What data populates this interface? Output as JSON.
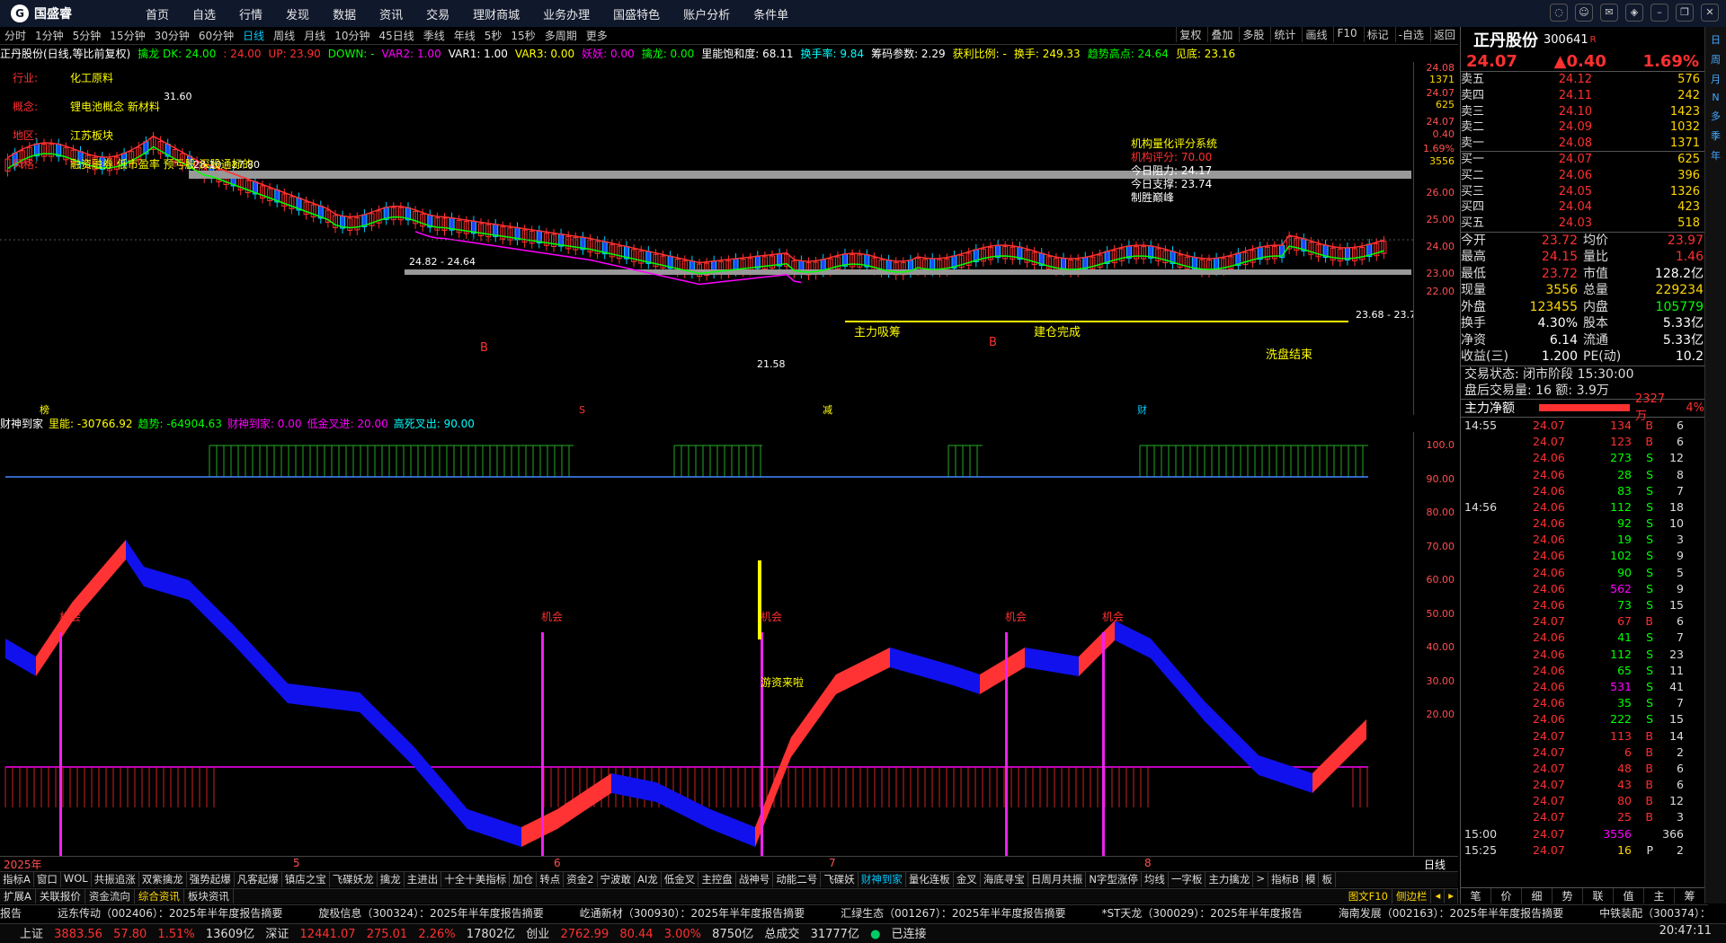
{
  "menu": {
    "brand": "国盛睿",
    "items": [
      "首页",
      "自选",
      "行情",
      "发现",
      "数据",
      "资讯",
      "交易",
      "理财商城",
      "业务办理",
      "国盛特色",
      "账户分析",
      "条件单"
    ],
    "win_icons": [
      "chat-icon",
      "person-icon",
      "mail-icon",
      "skin-icon",
      "minimize-icon",
      "restore-icon",
      "close-icon"
    ]
  },
  "periods": {
    "items": [
      "分时",
      "1分钟",
      "5分钟",
      "15分钟",
      "30分钟",
      "60分钟",
      "日线",
      "周线",
      "月线",
      "10分钟",
      "45日线",
      "季线",
      "年线",
      "5秒",
      "15秒",
      "多周期",
      "更多"
    ],
    "active": "日线",
    "right_tools": [
      "复权",
      "叠加",
      "多股",
      "统计",
      "画线",
      "F10",
      "标记",
      "-自选",
      "返回"
    ]
  },
  "ind_line": [
    {
      "t": "正丹股份(日线,等比前复权)",
      "c": "#ffffff"
    },
    {
      "t": "擒龙 DK: 24.00",
      "c": "#00ff00"
    },
    {
      "t": ": 24.00",
      "c": "#ff3030"
    },
    {
      "t": "UP: 23.90",
      "c": "#ff3030"
    },
    {
      "t": "DOWN: -",
      "c": "#00ff00"
    },
    {
      "t": "VAR2: 1.00",
      "c": "#ff00ff"
    },
    {
      "t": "VAR1: 1.00",
      "c": "#ffffff"
    },
    {
      "t": "VAR3: 0.00",
      "c": "#ffff00"
    },
    {
      "t": "妖妖: 0.00",
      "c": "#ff00ff"
    },
    {
      "t": "擒龙: 0.00",
      "c": "#00ff00"
    },
    {
      "t": "里能饱和度: 68.11",
      "c": "#ffffff"
    },
    {
      "t": "换手率: 9.84",
      "c": "#00ffff"
    },
    {
      "t": "筹码参数: 2.29",
      "c": "#ffffff"
    },
    {
      "t": "获利比例: -",
      "c": "#ffff00"
    },
    {
      "t": "换手: 249.33",
      "c": "#ffff00"
    },
    {
      "t": "趋势高点: 24.64",
      "c": "#00ff00"
    },
    {
      "t": "见底: 23.16",
      "c": "#ffff00"
    }
  ],
  "info_panel": {
    "rows": [
      {
        "k": "行业:",
        "v": "化工原料"
      },
      {
        "k": "概念:",
        "v": "锂电池概念 新材料"
      },
      {
        "k": "地区:",
        "v": "江苏板块"
      },
      {
        "k": "风格:",
        "v": "融资融券 低市盈率 预亏股 深股通标的"
      }
    ]
  },
  "score_panel": {
    "title": "机构量化评分系统",
    "score": "机构评分: 70.00",
    "res": "今日阻力: 24.17",
    "sup": "今日支撑: 23.74",
    "tag": "制胜巅峰"
  },
  "annotations": {
    "a1": "28.10 - 27.80",
    "a2": "24.82 - 24.64",
    "a3": "23.68 - 23.7",
    "low": "21.58",
    "hi": "31.60",
    "zl": "主力吸筹",
    "jc": "建仓完成",
    "xp": "洗盘结束",
    "b": "B",
    "s": "S",
    "jian": "减",
    "cai": "财",
    "bang": "榜"
  },
  "yaxis1": {
    "labels": [
      "24.08",
      "1371",
      "24.07",
      "625",
      "24.07",
      "0.40",
      "1.69%",
      "3556",
      "26.00",
      "25.00",
      "24.00",
      "23.00",
      "22.00"
    ]
  },
  "sub_line": [
    {
      "t": "财神到家",
      "c": "#ffffff"
    },
    {
      "t": "里能: -30766.92",
      "c": "#ffff00"
    },
    {
      "t": "趋势: -64904.63",
      "c": "#00ff00"
    },
    {
      "t": "财神到家: 0.00",
      "c": "#ff00ff"
    },
    {
      "t": "低金叉进: 20.00",
      "c": "#ff00ff"
    },
    {
      "t": "高死叉出: 90.00",
      "c": "#00ffff"
    }
  ],
  "sub_labels": {
    "chance": "机会",
    "fund": "游资来啦"
  },
  "yaxis2": {
    "labels": [
      "100.0",
      "90.00",
      "80.00",
      "70.00",
      "60.00",
      "50.00",
      "40.00",
      "30.00",
      "20.00"
    ]
  },
  "dates": {
    "year": "2025年",
    "m5": "5",
    "m6": "6",
    "m7": "7",
    "m8": "8",
    "right": "日线"
  },
  "tabs1": {
    "items": [
      "指标A",
      "窗口",
      "WOL",
      "共振追涨",
      "双紫擒龙",
      "强势起爆",
      "凡客起爆",
      "镇店之宝",
      "飞碟妖龙",
      "擒龙",
      "主进出",
      "十全十美指标",
      "加仓",
      "转点",
      "资金2",
      "宁波敢",
      "AI龙",
      "低金叉",
      "主控盘",
      "战神号",
      "动能二号",
      "飞碟妖",
      "财神到家",
      "量化连板",
      "金叉",
      "海底寻宝",
      "日周月共振",
      "N字型涨停",
      "均线",
      "一字板",
      "主力擒龙",
      ">",
      "指标B",
      "模",
      "板"
    ],
    "active": "财神到家"
  },
  "tabs2": {
    "items": [
      "扩展A",
      "关联报价",
      "资金流向",
      "综合资讯",
      "板块资讯"
    ],
    "active": "综合资讯",
    "right": [
      "图文F10",
      "侧边栏",
      "◂",
      "▸"
    ]
  },
  "news": [
    "报告",
    "远东传动（002406）：2025年半年度报告摘要",
    "旋极信息（300324）：2025年半年度报告摘要",
    "屹通新材（300930）：2025年半年度报告摘要",
    "汇绿生态（001267）：2025年半年度报告摘要",
    "*ST天龙（300029）：2025年半年度报告",
    "海南发展（002163）：2025年半年度报告摘要",
    "中铁装配（300374）：2025年半年度报告"
  ],
  "status": {
    "sh": "上证",
    "sh_v": "3883.56",
    "sh_c": "57.80",
    "sh_p": "1.51%",
    "sh_a": "13609亿",
    "sz": "深证",
    "sz_v": "12441.07",
    "sz_c": "275.01",
    "sz_p": "2.26%",
    "sz_a": "17802亿",
    "cy": "创业",
    "cy_v": "2762.99",
    "cy_c": "80.44",
    "cy_p": "3.00%",
    "cy_a": "8750亿",
    "tot": "总成交",
    "tot_v": "31777亿",
    "conn": "已连接",
    "time": "20:47:11"
  },
  "stock": {
    "name": "正丹股份",
    "code": "300641",
    "mark": "R",
    "price": "24.07",
    "chg": "▲0.40",
    "pct": "1.69%"
  },
  "orderbook": [
    {
      "l": "卖五",
      "p": "24.12",
      "v": "576"
    },
    {
      "l": "卖四",
      "p": "24.11",
      "v": "242"
    },
    {
      "l": "卖三",
      "p": "24.10",
      "v": "1423"
    },
    {
      "l": "卖二",
      "p": "24.09",
      "v": "1032"
    },
    {
      "l": "卖一",
      "p": "24.08",
      "v": "1371"
    },
    {
      "l": "买一",
      "p": "24.07",
      "v": "625"
    },
    {
      "l": "买二",
      "p": "24.06",
      "v": "396"
    },
    {
      "l": "买三",
      "p": "24.05",
      "v": "1326"
    },
    {
      "l": "买四",
      "p": "24.04",
      "v": "423"
    },
    {
      "l": "买五",
      "p": "24.03",
      "v": "518"
    }
  ],
  "stats": [
    {
      "a": "今开",
      "b": "23.72",
      "c": "均价",
      "d": "23.97"
    },
    {
      "a": "最高",
      "b": "24.15",
      "c": "量比",
      "d": "1.46"
    },
    {
      "a": "最低",
      "b": "23.72",
      "c": "市值",
      "d": "128.2亿"
    },
    {
      "a": "现量",
      "b": "3556",
      "c": "总量",
      "d": "229234"
    },
    {
      "a": "外盘",
      "b": "123455",
      "c": "内盘",
      "d": "105779"
    },
    {
      "a": "换手",
      "b": "4.30%",
      "c": "股本",
      "d": "5.33亿"
    },
    {
      "a": "净资",
      "b": "6.14",
      "c": "流通",
      "d": "5.33亿"
    },
    {
      "a": "收益(三)",
      "b": "1.200",
      "c": "PE(动)",
      "d": "10.2"
    }
  ],
  "trade_state": "交易状态: 闭市阶段 15:30:00",
  "after_trade": "盘后交易量: 16  额: 3.9万",
  "netflow": {
    "label": "主力净额",
    "value": "2327万",
    "pct": "4%"
  },
  "ticks": [
    {
      "t": "14:55",
      "p": "24.07",
      "v": "134",
      "d": "B",
      "n": "6"
    },
    {
      "t": "",
      "p": "24.07",
      "v": "123",
      "d": "B",
      "n": "6"
    },
    {
      "t": "",
      "p": "24.06",
      "v": "273",
      "d": "S",
      "n": "12"
    },
    {
      "t": "",
      "p": "24.06",
      "v": "28",
      "d": "S",
      "n": "8"
    },
    {
      "t": "",
      "p": "24.06",
      "v": "83",
      "d": "S",
      "n": "7"
    },
    {
      "t": "14:56",
      "p": "24.06",
      "v": "112",
      "d": "S",
      "n": "18"
    },
    {
      "t": "",
      "p": "24.06",
      "v": "92",
      "d": "S",
      "n": "10"
    },
    {
      "t": "",
      "p": "24.06",
      "v": "19",
      "d": "S",
      "n": "3"
    },
    {
      "t": "",
      "p": "24.06",
      "v": "102",
      "d": "S",
      "n": "9"
    },
    {
      "t": "",
      "p": "24.06",
      "v": "90",
      "d": "S",
      "n": "5"
    },
    {
      "t": "",
      "p": "24.06",
      "v": "562",
      "d": "S",
      "n": "9"
    },
    {
      "t": "",
      "p": "24.06",
      "v": "73",
      "d": "S",
      "n": "15"
    },
    {
      "t": "",
      "p": "24.07",
      "v": "67",
      "d": "B",
      "n": "6"
    },
    {
      "t": "",
      "p": "24.06",
      "v": "41",
      "d": "S",
      "n": "7"
    },
    {
      "t": "",
      "p": "24.06",
      "v": "112",
      "d": "S",
      "n": "23"
    },
    {
      "t": "",
      "p": "24.06",
      "v": "65",
      "d": "S",
      "n": "11"
    },
    {
      "t": "",
      "p": "24.06",
      "v": "531",
      "d": "S",
      "n": "41"
    },
    {
      "t": "",
      "p": "24.06",
      "v": "35",
      "d": "S",
      "n": "7"
    },
    {
      "t": "",
      "p": "24.06",
      "v": "222",
      "d": "S",
      "n": "15"
    },
    {
      "t": "",
      "p": "24.07",
      "v": "113",
      "d": "B",
      "n": "14"
    },
    {
      "t": "",
      "p": "24.07",
      "v": "6",
      "d": "B",
      "n": "2"
    },
    {
      "t": "",
      "p": "24.07",
      "v": "48",
      "d": "B",
      "n": "6"
    },
    {
      "t": "",
      "p": "24.07",
      "v": "43",
      "d": "B",
      "n": "6"
    },
    {
      "t": "",
      "p": "24.07",
      "v": "80",
      "d": "B",
      "n": "12"
    },
    {
      "t": "",
      "p": "24.07",
      "v": "25",
      "d": "B",
      "n": "3"
    },
    {
      "t": "15:00",
      "p": "24.07",
      "v": "3556",
      "d": "",
      "n": "366"
    },
    {
      "t": "15:25",
      "p": "24.07",
      "v": "16",
      "d": "P",
      "n": "2"
    }
  ],
  "rtabs": [
    "笔",
    "价",
    "细",
    "势",
    "联",
    "值",
    "主",
    "筹"
  ],
  "side_strip": [
    "日",
    "周",
    "月",
    "N",
    "多",
    "季",
    "年"
  ]
}
